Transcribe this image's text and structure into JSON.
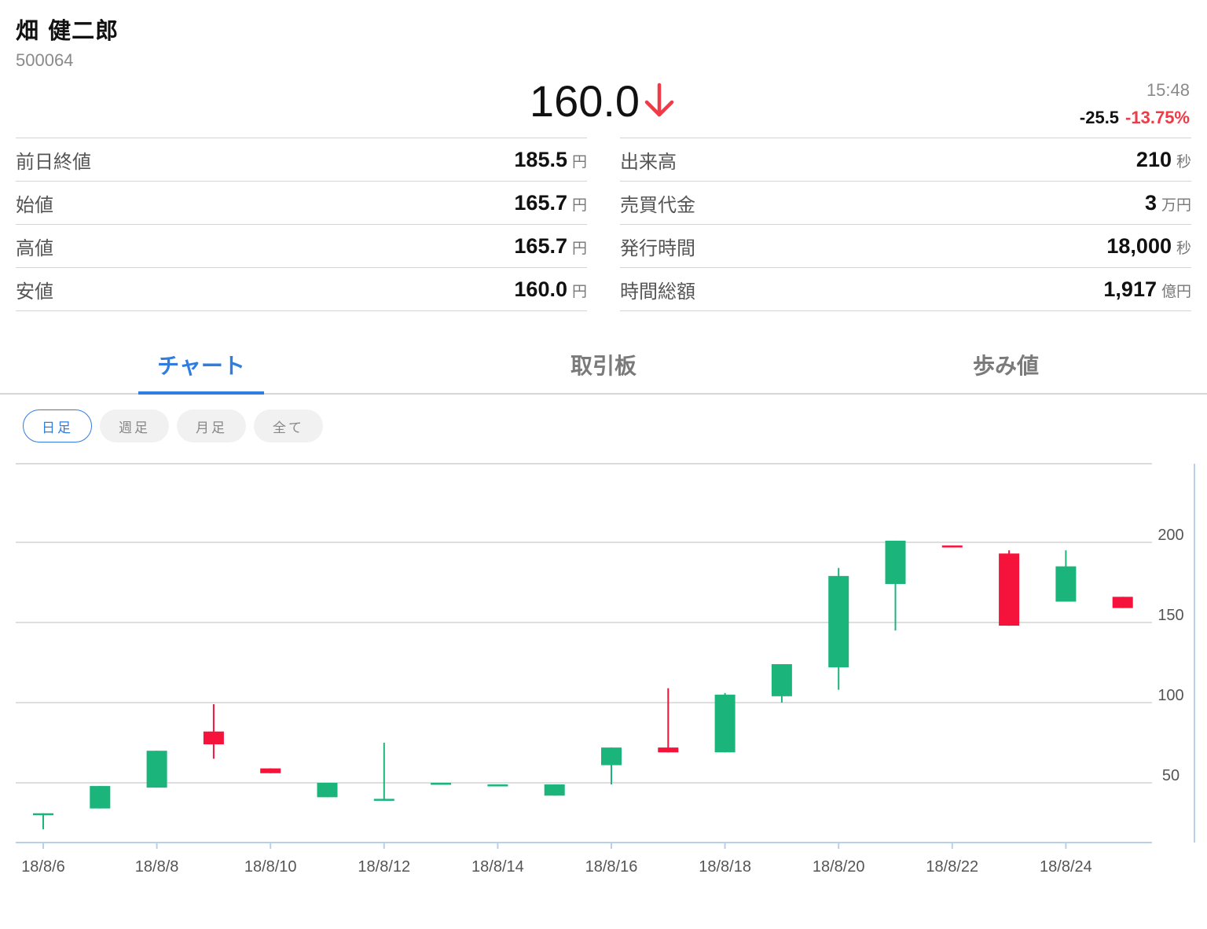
{
  "header": {
    "name": "畑 健二郎",
    "code": "500064",
    "price": "160.0",
    "time": "15:48",
    "change_abs": "-25.5",
    "change_pct": "-13.75%",
    "colors": {
      "down": "#f03a47",
      "accent": "#2f7de1"
    }
  },
  "stats": {
    "left": [
      {
        "label": "前日終値",
        "value": "185.5",
        "unit": "円"
      },
      {
        "label": "始値",
        "value": "165.7",
        "unit": "円"
      },
      {
        "label": "高値",
        "value": "165.7",
        "unit": "円"
      },
      {
        "label": "安値",
        "value": "160.0",
        "unit": "円"
      }
    ],
    "right": [
      {
        "label": "出来高",
        "value": "210",
        "unit": "秒"
      },
      {
        "label": "売買代金",
        "value": "3",
        "unit": "万円"
      },
      {
        "label": "発行時間",
        "value": "18,000",
        "unit": "秒"
      },
      {
        "label": "時間総額",
        "value": "1,917",
        "unit": "億円"
      }
    ]
  },
  "tabs": [
    {
      "label": "チャート",
      "active": true
    },
    {
      "label": "取引板",
      "active": false
    },
    {
      "label": "歩み値",
      "active": false
    }
  ],
  "periods": [
    {
      "label": "日足",
      "active": true
    },
    {
      "label": "週足",
      "active": false
    },
    {
      "label": "月足",
      "active": false
    },
    {
      "label": "全て",
      "active": false
    }
  ],
  "chart_data": {
    "type": "candlestick",
    "x": [
      "18/8/6",
      "18/8/7",
      "18/8/8",
      "18/8/9",
      "18/8/10",
      "18/8/11",
      "18/8/12",
      "18/8/13",
      "18/8/14",
      "18/8/15",
      "18/8/16",
      "18/8/17",
      "18/8/18",
      "18/8/19",
      "18/8/20",
      "18/8/21",
      "18/8/22",
      "18/8/23",
      "18/8/24",
      "18/8/25"
    ],
    "x_tick_labels": [
      "18/8/6",
      "18/8/8",
      "18/8/10",
      "18/8/12",
      "18/8/14",
      "18/8/16",
      "18/8/18",
      "18/8/20",
      "18/8/22",
      "18/8/24"
    ],
    "candles": [
      {
        "open": 31,
        "high": 31,
        "low": 21,
        "close": 31
      },
      {
        "open": 34,
        "high": 48,
        "low": 34,
        "close": 48
      },
      {
        "open": 47,
        "high": 70,
        "low": 47,
        "close": 70
      },
      {
        "open": 82,
        "high": 99,
        "low": 65,
        "close": 74
      },
      {
        "open": 59,
        "high": 59,
        "low": 56,
        "close": 56
      },
      {
        "open": 41,
        "high": 50,
        "low": 41,
        "close": 50
      },
      {
        "open": 40,
        "high": 75,
        "low": 39,
        "close": 40
      },
      {
        "open": 49,
        "high": 50,
        "low": 49,
        "close": 50
      },
      {
        "open": 48,
        "high": 49,
        "low": 48,
        "close": 49
      },
      {
        "open": 42,
        "high": 49,
        "low": 42,
        "close": 49
      },
      {
        "open": 61,
        "high": 72,
        "low": 49,
        "close": 72
      },
      {
        "open": 72,
        "high": 109,
        "low": 69,
        "close": 69
      },
      {
        "open": 69,
        "high": 106,
        "low": 69,
        "close": 105
      },
      {
        "open": 104,
        "high": 124,
        "low": 100,
        "close": 124
      },
      {
        "open": 122,
        "high": 184,
        "low": 108,
        "close": 179
      },
      {
        "open": 174,
        "high": 201,
        "low": 145,
        "close": 201
      },
      {
        "open": 198,
        "high": 198,
        "low": 197,
        "close": 197
      },
      {
        "open": 193,
        "high": 195,
        "low": 148,
        "close": 148
      },
      {
        "open": 163,
        "high": 195,
        "low": 163,
        "close": 185
      },
      {
        "open": 166,
        "high": 166,
        "low": 159,
        "close": 159
      }
    ],
    "y_ticks": [
      50,
      100,
      150,
      200
    ],
    "ylim": [
      0,
      250
    ],
    "grid": true,
    "colors": {
      "up": "#1bb57c",
      "down": "#f5123b"
    }
  }
}
